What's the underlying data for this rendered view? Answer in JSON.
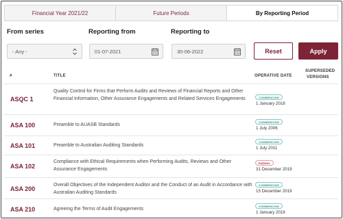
{
  "tabs": [
    {
      "label": "Financial Year 2021/22",
      "active": false
    },
    {
      "label": "Future Periods",
      "active": false
    },
    {
      "label": "By Reporting Period",
      "active": true
    }
  ],
  "filters": {
    "from_series_label": "From series",
    "from_series_value": "- Any -",
    "reporting_from_label": "Reporting from",
    "reporting_from_value": "01-07-2021",
    "reporting_to_label": "Reporting to",
    "reporting_to_value": "30-06-2022",
    "reset_label": "Reset",
    "apply_label": "Apply"
  },
  "table": {
    "headers": {
      "num": "#",
      "title": "TITLE",
      "operative_date": "OPERATIVE DATE",
      "superseded_line1": "SUPERSEDED",
      "superseded_line2": "VERSIONS"
    },
    "rows": [
      {
        "code": "ASQC 1",
        "title": "Quality Control for Firms that Perform Audits and Reviews of Financial Reports and Other Financial Information, Other Assurance Engagements and Related Services Engagements",
        "status": "COMMENCING",
        "date": "1 January 2018"
      },
      {
        "code": "ASA 100",
        "title": "Preamble to AUASB Standards",
        "status": "COMMENCING",
        "date": "1 July 2006"
      },
      {
        "code": "ASA 101",
        "title": "Preamble to Australian Auditing Standards",
        "status": "COMMENCING",
        "date": "1 July 2011"
      },
      {
        "code": "ASA 102",
        "title": "Compliance with Ethical Requirements when Performing Audits, Reviews and Other Assurance Engagements",
        "status": "ENDING",
        "date": "31 December 2019"
      },
      {
        "code": "ASA 200",
        "title": "Overall Objectives of the Independent Auditor and the Conduct of an Audit in Accordance with Australian Auditing Standards",
        "status": "COMMENCING",
        "date": "15 December 2019"
      },
      {
        "code": "ASA 210",
        "title": "Agreeing the Terms of Audit Engagements",
        "status": "COMMENCING",
        "date": "1 January 2018"
      }
    ]
  },
  "colors": {
    "brand": "#7e2437",
    "commencing": "#2f8f86",
    "ending": "#b3263a"
  }
}
